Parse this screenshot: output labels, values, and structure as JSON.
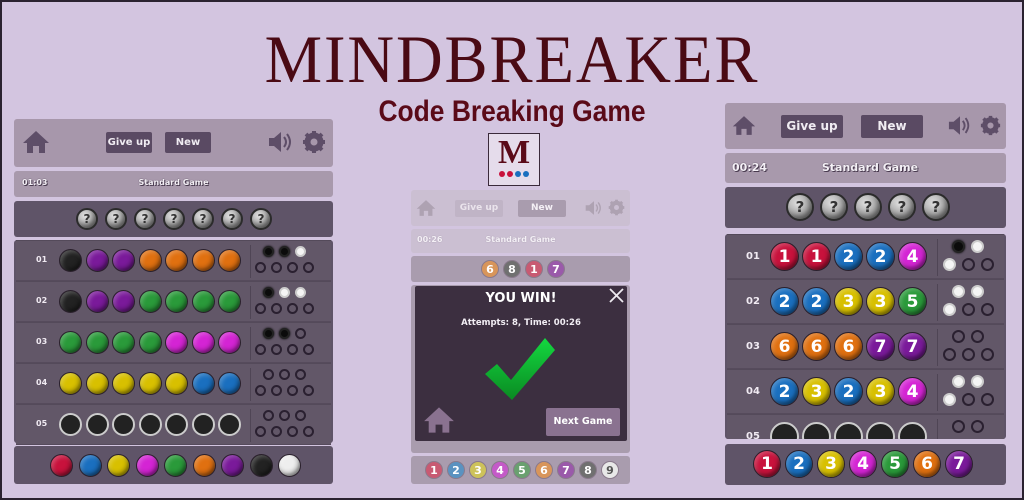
{
  "header": {
    "title": "MINDBREAKER",
    "subtitle": "Code Breaking Game",
    "logo_letter": "M",
    "logo_dots": [
      "#c8123c",
      "#c8123c",
      "#1a6fbf",
      "#1a6fbf"
    ]
  },
  "colors": {
    "background": "#d3c5e0",
    "title": "#4a0a14",
    "panel_light": "#a797ab",
    "panel_dark": "#5f5468",
    "button": "#5a4a63",
    "red": "#c8123c",
    "blue": "#1a6fbf",
    "yellow": "#d8c000",
    "magenta": "#d424d4",
    "green": "#2a9a3a",
    "orange": "#e07010",
    "purple": "#7a1a9a",
    "black": "#222222",
    "white": "#eeeeee",
    "check_green": "#10c030"
  },
  "left_screen": {
    "toolbar": {
      "give_up": "Give up",
      "new": "New"
    },
    "status": {
      "time": "01:03",
      "mode": "Standard Game"
    },
    "secret": [
      "?",
      "?",
      "?",
      "?",
      "?",
      "?",
      "?"
    ],
    "rows": [
      {
        "label": "01",
        "balls": [
          "black",
          "purple",
          "purple",
          "orange",
          "orange",
          "orange",
          "orange"
        ],
        "pegs": [
          "b",
          "b",
          "w",
          "e",
          "e",
          "e",
          "e"
        ]
      },
      {
        "label": "02",
        "balls": [
          "black",
          "purple",
          "purple",
          "green",
          "green",
          "green",
          "green"
        ],
        "pegs": [
          "b",
          "w",
          "w",
          "e",
          "e",
          "e",
          "e"
        ]
      },
      {
        "label": "03",
        "balls": [
          "green",
          "green",
          "green",
          "green",
          "magenta",
          "magenta",
          "magenta"
        ],
        "pegs": [
          "b",
          "b",
          "e",
          "e",
          "e",
          "e",
          "e"
        ]
      },
      {
        "label": "04",
        "balls": [
          "yellow",
          "yellow",
          "yellow",
          "yellow",
          "yellow",
          "blue",
          "blue"
        ],
        "pegs": [
          "e",
          "e",
          "e",
          "e",
          "e",
          "e",
          "e"
        ]
      },
      {
        "label": "05",
        "balls": [
          "empty",
          "empty",
          "empty",
          "empty",
          "empty",
          "empty",
          "empty"
        ],
        "pegs": [
          "e",
          "e",
          "e",
          "e",
          "e",
          "e",
          "e"
        ]
      }
    ],
    "palette": [
      "red",
      "blue",
      "yellow",
      "magenta",
      "green",
      "orange",
      "purple",
      "black",
      "white"
    ]
  },
  "middle_screen": {
    "toolbar": {
      "give_up": "Give up",
      "new": "New"
    },
    "status": {
      "time": "00:26",
      "mode": "Standard Game"
    },
    "secret": [
      {
        "n": "6",
        "color": "#d8955a"
      },
      {
        "n": "8",
        "color": "#707070"
      },
      {
        "n": "1",
        "color": "#c85a72"
      },
      {
        "n": "7",
        "color": "#9a5aaa"
      }
    ],
    "dialog": {
      "title": "YOU WIN!",
      "details": "Attempts: 8, Time: 00:26",
      "next_game": "Next Game"
    },
    "palette": [
      {
        "n": "1",
        "color": "#c85a72"
      },
      {
        "n": "2",
        "color": "#5a92c0"
      },
      {
        "n": "3",
        "color": "#cdc25a"
      },
      {
        "n": "4",
        "color": "#c45ac8"
      },
      {
        "n": "5",
        "color": "#6aa070"
      },
      {
        "n": "6",
        "color": "#d8955a"
      },
      {
        "n": "7",
        "color": "#9a5aaa"
      },
      {
        "n": "8",
        "color": "#707070"
      },
      {
        "n": "9",
        "color": "#e8e8e8"
      }
    ]
  },
  "right_screen": {
    "toolbar": {
      "give_up": "Give up",
      "new": "New"
    },
    "status": {
      "time": "00:24",
      "mode": "Standard Game"
    },
    "secret": [
      "?",
      "?",
      "?",
      "?",
      "?"
    ],
    "rows": [
      {
        "label": "01",
        "balls": [
          "1",
          "1",
          "2",
          "2",
          "4"
        ],
        "pegs": [
          "b",
          "w",
          "w",
          "e",
          "e"
        ]
      },
      {
        "label": "02",
        "balls": [
          "2",
          "2",
          "3",
          "3",
          "5"
        ],
        "pegs": [
          "w",
          "w",
          "w",
          "e",
          "e"
        ]
      },
      {
        "label": "03",
        "balls": [
          "6",
          "6",
          "6",
          "7",
          "7"
        ],
        "pegs": [
          "e",
          "e",
          "e",
          "e",
          "e"
        ]
      },
      {
        "label": "04",
        "balls": [
          "2",
          "3",
          "2",
          "3",
          "4"
        ],
        "pegs": [
          "w",
          "w",
          "w",
          "e",
          "e"
        ]
      },
      {
        "label": "05",
        "balls": [
          "",
          "",
          "",
          "",
          ""
        ],
        "pegs": [
          "e",
          "e"
        ]
      }
    ],
    "palette": [
      "1",
      "2",
      "3",
      "4",
      "5",
      "6",
      "7"
    ]
  }
}
